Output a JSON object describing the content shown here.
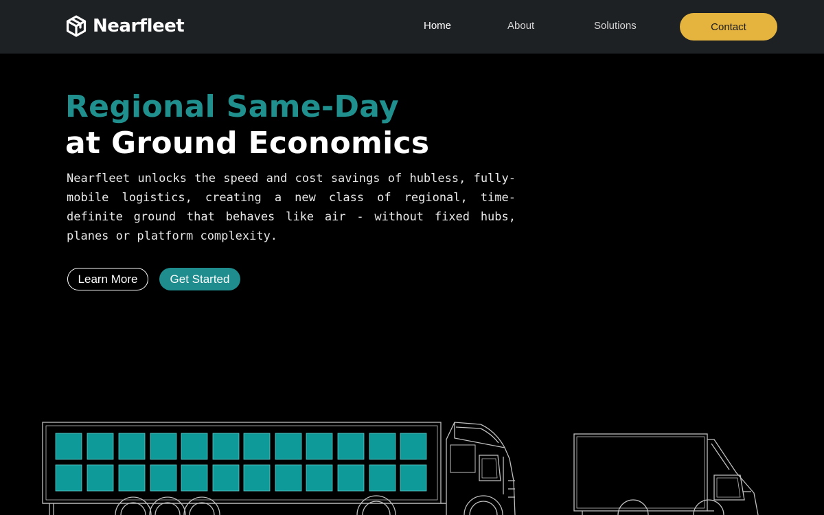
{
  "brand": {
    "name": "Nearfleet",
    "logo_icon": "cube-box-icon"
  },
  "nav": {
    "items": [
      {
        "label": "Home",
        "active": true
      },
      {
        "label": "About",
        "active": false
      },
      {
        "label": "Solutions",
        "active": false
      }
    ],
    "cta_label": "Contact"
  },
  "hero": {
    "headline_line1": "Regional Same-Day",
    "headline_line2": "at Ground Economics",
    "description": "Nearfleet unlocks the speed and cost savings of hubless, fully-mobile logistics, creating a new class of regional, time-definite ground that behaves like air - without fixed hubs, planes or platform complexity.",
    "buttons": {
      "learn_more": "Learn More",
      "get_started": "Get Started"
    }
  },
  "colors": {
    "nav_bg": "#1e2124",
    "page_bg": "#000000",
    "accent_teal": "#20908f",
    "accent_gold": "#e5b43e",
    "cargo_fill": "#0f9a9a"
  }
}
